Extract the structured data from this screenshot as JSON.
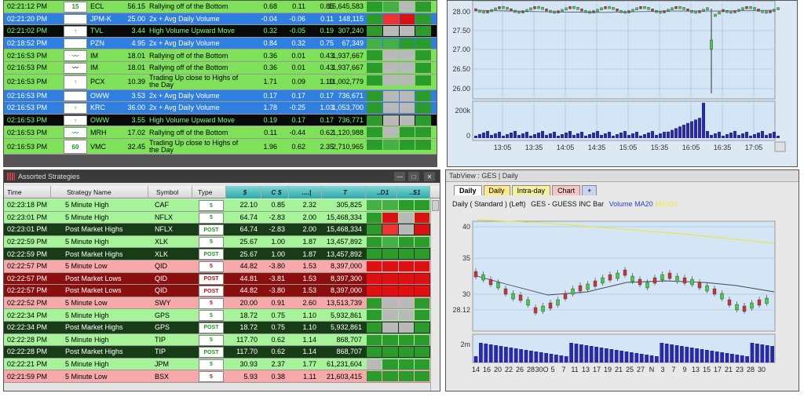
{
  "top_rows": [
    {
      "time": "02:21:12 PM",
      "sym": "ECL",
      "strat_val": "56.15",
      "desc": "Rallying off of the Bottom",
      "c1": "0.68",
      "c2": "0.11",
      "c3": "0.85",
      "c4": "15,645,583",
      "bg": "#7fe05a",
      "fg": "#000",
      "ic": "15",
      "ic_color": "#1a9a1a"
    },
    {
      "time": "02:21:20 PM",
      "sym": "JPM-K",
      "strat_val": "25.00",
      "desc": "2x + Avg Daily Volume",
      "c1": "-0.04",
      "c2": "-0.06",
      "c3": "0.11",
      "c4": "148,115",
      "bg": "#2f7fe0",
      "fg": "#fff",
      "ic": "",
      "ic_color": "#1a3a9a"
    },
    {
      "time": "02:21:02 PM",
      "sym": "TVL",
      "strat_val": "3.44",
      "desc": "High Volume Upward Move",
      "c1": "0.32",
      "c2": "-0.05",
      "c3": "0.19",
      "c4": "307,240",
      "bg": "#0a0a0a",
      "fg": "#7f7",
      "ic": "↑",
      "ic_color": "#1a9a1a"
    },
    {
      "time": "02:18:52 PM",
      "sym": "PZN",
      "strat_val": "4.95",
      "desc": "2x + Avg Daily Volume",
      "c1": "0.84",
      "c2": "0.32",
      "c3": "0.75",
      "c4": "67,349",
      "bg": "#2f7fe0",
      "fg": "#fff",
      "ic": "",
      "ic_color": "#1a3a9a"
    },
    {
      "time": "02:16:53 PM",
      "sym": "IM",
      "strat_val": "18.01",
      "desc": "Rallying off of the Bottom",
      "c1": "0.36",
      "c2": "0.01",
      "c3": "0.43",
      "c4": "1,937,667",
      "bg": "#7fe05a",
      "fg": "#000",
      "ic": "〰",
      "ic_color": "#1a9a1a"
    },
    {
      "time": "02:16:53 PM",
      "sym": "IM",
      "strat_val": "18.01",
      "desc": "Rallying off of the Bottom",
      "c1": "0.36",
      "c2": "0.01",
      "c3": "0.43",
      "c4": "1,937,667",
      "bg": "#7fe05a",
      "fg": "#000",
      "ic": "〰",
      "ic_color": "#1a3a9a"
    },
    {
      "time": "02:16:53 PM",
      "sym": "PCX",
      "strat_val": "10.39",
      "desc": "Trading Up close to Highs of the Day",
      "c1": "1.71",
      "c2": "0.09",
      "c3": "1.10",
      "c4": "11,002,779",
      "bg": "#7fe05a",
      "fg": "#000",
      "ic": "↑",
      "ic_color": "#1a9a1a",
      "tall": true
    },
    {
      "time": "02:16:53 PM",
      "sym": "OWW",
      "strat_val": "3.53",
      "desc": "2x + Avg Daily Volume",
      "c1": "0.17",
      "c2": "0.17",
      "c3": "0.17",
      "c4": "736,671",
      "bg": "#2f7fe0",
      "fg": "#fff",
      "ic": "",
      "ic_color": "#1a3a9a"
    },
    {
      "time": "02:16:53 PM",
      "sym": "KRC",
      "strat_val": "36.00",
      "desc": "2x + Avg Daily Volume",
      "c1": "1.78",
      "c2": "-0.25",
      "c3": "1.03",
      "c4": "1,053,700",
      "bg": "#2f7fe0",
      "fg": "#fff",
      "ic": "↑",
      "ic_color": "#1a9a1a"
    },
    {
      "time": "02:16:53 PM",
      "sym": "OWW",
      "strat_val": "3.55",
      "desc": "High Volume Upward Move",
      "c1": "0.19",
      "c2": "0.17",
      "c3": "0.17",
      "c4": "736,771",
      "bg": "#0a0a0a",
      "fg": "#7f7",
      "ic": "↑",
      "ic_color": "#1a9a1a"
    },
    {
      "time": "02:16:53 PM",
      "sym": "MRH",
      "strat_val": "17.02",
      "desc": "Rallying off of the Bottom",
      "c1": "0.11",
      "c2": "-0.44",
      "c3": "0.62",
      "c4": "1,120,988",
      "bg": "#7fe05a",
      "fg": "#000",
      "ic": "〰",
      "ic_color": "#1a9a1a"
    },
    {
      "time": "02:16:53 PM",
      "sym": "VMC",
      "strat_val": "32.45",
      "desc": "Trading Up close to Highs of the Day",
      "c1": "1.96",
      "c2": "0.62",
      "c3": "2.35",
      "c4": "2,710,965",
      "bg": "#7fe05a",
      "fg": "#000",
      "ic": "60",
      "ic_color": "#1a9a1a",
      "tall": true
    }
  ],
  "assorted": {
    "title": "Assorted Strategies",
    "headers": [
      "Time",
      "Strategy Name",
      "Symbol",
      "Type",
      "$",
      "C $",
      "....|",
      "T",
      "..D1",
      "..$1"
    ],
    "rows": [
      {
        "time": "02:23:18 PM",
        "strat": "5 Minute High",
        "sym": "CAF",
        "type": "5",
        "c1": "22.10",
        "c2": "0.85",
        "c3": "2.32",
        "c4": "305,825",
        "bg": "#a6f39a",
        "dark": false,
        "down": false
      },
      {
        "time": "02:23:01 PM",
        "strat": "5 Minute High",
        "sym": "NFLX",
        "type": "5",
        "c1": "64.74",
        "c2": "-2.83",
        "c3": "2.00",
        "c4": "15,468,334",
        "bg": "#a6f39a",
        "dark": false,
        "down": false
      },
      {
        "time": "02:23:01 PM",
        "strat": "Post Market Highs",
        "sym": "NFLX",
        "type": "POST",
        "c1": "64.74",
        "c2": "-2.83",
        "c3": "2.00",
        "c4": "15,468,334",
        "bg": "#163d16",
        "dark": true,
        "down": false
      },
      {
        "time": "02:22:59 PM",
        "strat": "5 Minute High",
        "sym": "XLK",
        "type": "5",
        "c1": "25.67",
        "c2": "1.00",
        "c3": "1.87",
        "c4": "13,457,892",
        "bg": "#a6f39a",
        "dark": false,
        "down": false
      },
      {
        "time": "02:22:59 PM",
        "strat": "Post Market Highs",
        "sym": "XLK",
        "type": "POST",
        "c1": "25.67",
        "c2": "1.00",
        "c3": "1.87",
        "c4": "13,457,892",
        "bg": "#163d16",
        "dark": true,
        "down": false
      },
      {
        "time": "02:22:57 PM",
        "strat": "5 Minute Low",
        "sym": "QID",
        "type": "5",
        "c1": "44.82",
        "c2": "-3.80",
        "c3": "1.53",
        "c4": "8,397,000",
        "bg": "#f7a8a8",
        "dark": false,
        "down": true
      },
      {
        "time": "02:22:57 PM",
        "strat": "Post Market Lows",
        "sym": "QID",
        "type": "POST",
        "c1": "44.81",
        "c2": "-3.81",
        "c3": "1.53",
        "c4": "8,397,300",
        "bg": "#8a1010",
        "dark": true,
        "down": true
      },
      {
        "time": "02:22:57 PM",
        "strat": "Post Market Lows",
        "sym": "QID",
        "type": "POST",
        "c1": "44.82",
        "c2": "-3.80",
        "c3": "1.53",
        "c4": "8,397,000",
        "bg": "#8a1010",
        "dark": true,
        "down": true
      },
      {
        "time": "02:22:52 PM",
        "strat": "5 Minute Low",
        "sym": "SWY",
        "type": "5",
        "c1": "20.00",
        "c2": "0.91",
        "c3": "2.60",
        "c4": "13,513,739",
        "bg": "#f7a8a8",
        "dark": false,
        "down": true
      },
      {
        "time": "02:22:34 PM",
        "strat": "5 Minute High",
        "sym": "GPS",
        "type": "5",
        "c1": "18.72",
        "c2": "0.75",
        "c3": "1.10",
        "c4": "5,932,861",
        "bg": "#a6f39a",
        "dark": false,
        "down": false
      },
      {
        "time": "02:22:34 PM",
        "strat": "Post Market Highs",
        "sym": "GPS",
        "type": "POST",
        "c1": "18.72",
        "c2": "0.75",
        "c3": "1.10",
        "c4": "5,932,861",
        "bg": "#163d16",
        "dark": true,
        "down": false
      },
      {
        "time": "02:22:28 PM",
        "strat": "5 Minute High",
        "sym": "TIP",
        "type": "5",
        "c1": "117.70",
        "c2": "0.62",
        "c3": "1.14",
        "c4": "868,707",
        "bg": "#a6f39a",
        "dark": false,
        "down": false
      },
      {
        "time": "02:22:28 PM",
        "strat": "Post Market Highs",
        "sym": "TIP",
        "type": "POST",
        "c1": "117.70",
        "c2": "0.62",
        "c3": "1.14",
        "c4": "868,707",
        "bg": "#163d16",
        "dark": true,
        "down": false
      },
      {
        "time": "02:22:21 PM",
        "strat": "5 Minute High",
        "sym": "JPM",
        "type": "5",
        "c1": "30.93",
        "c2": "2.37",
        "c3": "1.77",
        "c4": "61,231,604",
        "bg": "#a6f39a",
        "dark": false,
        "down": false
      },
      {
        "time": "02:21:59 PM",
        "strat": "5 Minute Low",
        "sym": "BSX",
        "type": "5",
        "c1": "5.93",
        "c2": "0.38",
        "c3": "1.11",
        "c4": "21,603,415",
        "bg": "#f7a8a8",
        "dark": false,
        "down": true
      }
    ]
  },
  "intraday_chart": {
    "ytick": [
      "28.00",
      "27.50",
      "27.00",
      "26.50",
      "26.00"
    ],
    "xtick": [
      "13:05",
      "13:35",
      "14:05",
      "14:35",
      "15:05",
      "15:35",
      "16:05",
      "16:35",
      "17:05"
    ],
    "vol_tick": [
      "200k",
      "0"
    ]
  },
  "tabview": {
    "title": "TabView : GES | Daily",
    "tabs": [
      "Daily",
      "Daily",
      "Intra-day",
      "Chart",
      "+"
    ],
    "legend_prefix": "Daily ( Standard ) (Left)",
    "legend_symbol": "GES - GUESS INC",
    "legend_type": "Bar",
    "legend_vol": "Volume",
    "legend_ma20": "MA20",
    "legend_ma200": "MA200",
    "ytick": [
      "40",
      "35",
      "30",
      "28.12"
    ],
    "vol_tick": "2m",
    "xtick": [
      "14",
      "16",
      "20",
      "22",
      "26",
      "28",
      "30O",
      "5",
      "7",
      "11",
      "13",
      "17",
      "19",
      "21",
      "25",
      "27",
      "N",
      "3",
      "7",
      "9",
      "13",
      "15",
      "17",
      "21",
      "23",
      "28",
      "30"
    ]
  },
  "colors": {
    "accent": "#2f7fe0",
    "up": "#1a9a1a",
    "down": "#c01010"
  }
}
